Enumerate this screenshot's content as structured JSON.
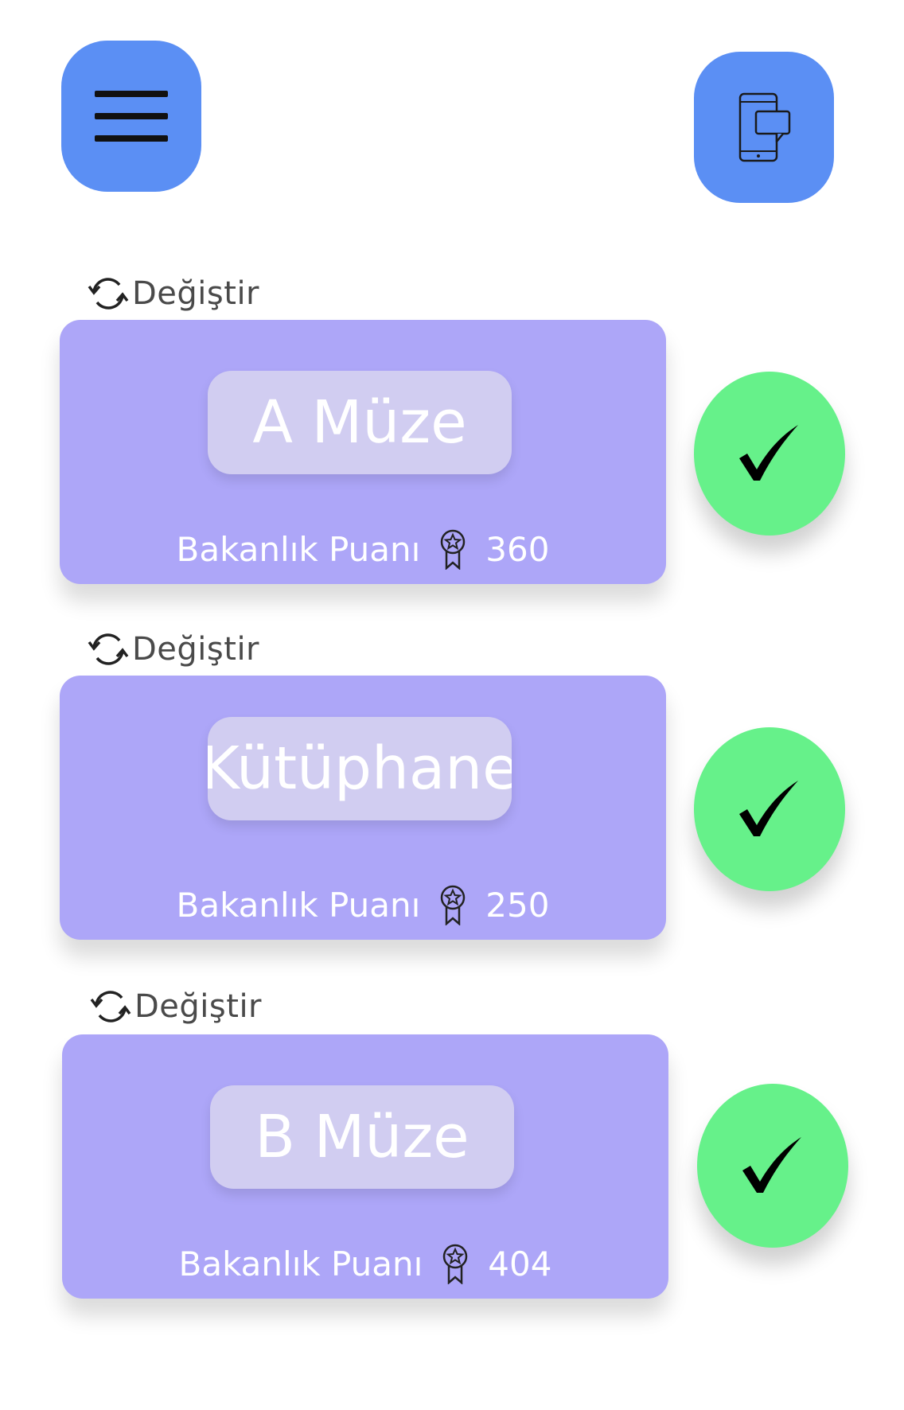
{
  "header": {
    "menu_icon": "hamburger-menu-icon",
    "messages_icon": "phone-message-icon",
    "accent_color": "#5b8ff4"
  },
  "change_label": "Değiştir",
  "items": [
    {
      "name": "A Müze",
      "score_label": "Bakanlık Puanı",
      "score": "360"
    },
    {
      "name": "Kütüphane",
      "score_label": "Bakanlık Puanı",
      "score": "250"
    },
    {
      "name": "B Müze",
      "score_label": "Bakanlık Puanı",
      "score": "404"
    }
  ],
  "colors": {
    "card": "#ada6f8",
    "pill": "#d1cdf1",
    "check": "#66f18a"
  }
}
